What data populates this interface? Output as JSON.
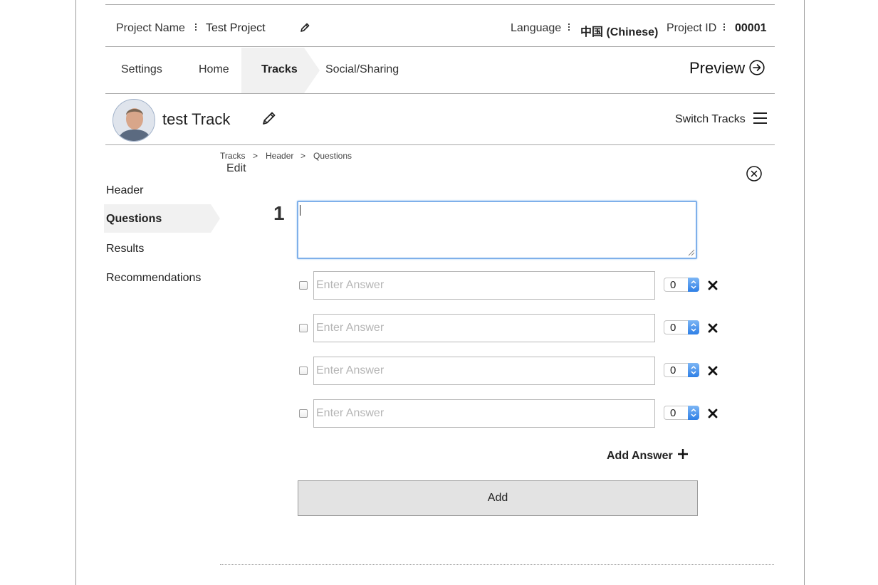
{
  "project_bar": {
    "project_name_label": "Project Name",
    "project_name_value": "Test Project",
    "language_label": "Language",
    "language_value": "中国 (Chinese)",
    "project_id_label": "Project ID",
    "project_id_value": "00001"
  },
  "nav": {
    "tabs": [
      {
        "label": "Settings"
      },
      {
        "label": "Home"
      },
      {
        "label": "Tracks",
        "active": true
      },
      {
        "label": "Social/Sharing"
      }
    ],
    "preview_label": "Preview"
  },
  "track": {
    "title": "test Track",
    "switch_label": "Switch Tracks"
  },
  "breadcrumb": {
    "items": [
      "Tracks",
      "Header",
      "Questions"
    ],
    "separator": ">",
    "mode_label": "Edit"
  },
  "side_menu": {
    "items": [
      {
        "label": "Header"
      },
      {
        "label": "Questions",
        "active": true
      },
      {
        "label": "Results"
      },
      {
        "label": "Recommendations"
      }
    ]
  },
  "question": {
    "number": "1",
    "text": "",
    "answers": [
      {
        "placeholder": "Enter Answer",
        "value": "",
        "points": "0"
      },
      {
        "placeholder": "Enter Answer",
        "value": "",
        "points": "0"
      },
      {
        "placeholder": "Enter Answer",
        "value": "",
        "points": "0"
      },
      {
        "placeholder": "Enter Answer",
        "value": "",
        "points": "0"
      }
    ],
    "add_answer_label": "Add Answer",
    "add_button_label": "Add"
  },
  "colors": {
    "focus_border": "#7fb0ea",
    "select_accent": "#2e7fe6",
    "active_tab_bg": "#f1f1f1"
  }
}
